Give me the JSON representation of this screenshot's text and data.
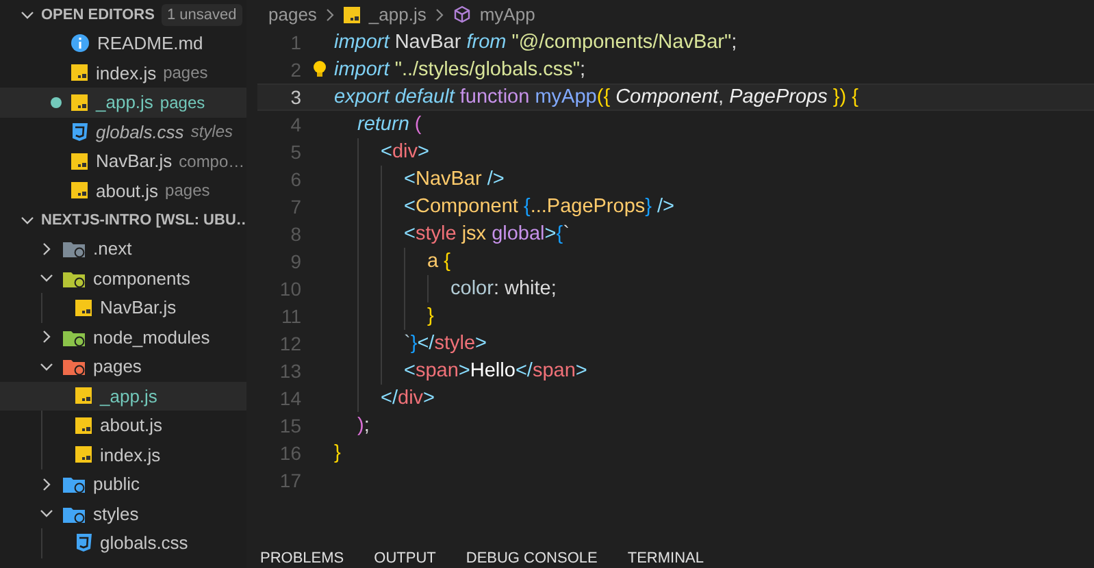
{
  "open_editors": {
    "title": "OPEN EDITORS",
    "expanded": true,
    "badge": "1 unsaved",
    "items": [
      {
        "kind": "info",
        "name": "README.md",
        "selected": false,
        "unsaved": false,
        "preview": false,
        "modified": false
      },
      {
        "kind": "js",
        "name": "index.js",
        "detail": "pages",
        "selected": false,
        "unsaved": false,
        "preview": false,
        "modified": false
      },
      {
        "kind": "js",
        "name": "_app.js",
        "detail": "pages",
        "selected": true,
        "unsaved": true,
        "preview": false,
        "modified": true
      },
      {
        "kind": "css",
        "name": "globals.css",
        "detail": "styles",
        "selected": false,
        "unsaved": false,
        "preview": true,
        "modified": false
      },
      {
        "kind": "js",
        "name": "NavBar.js",
        "detail": "compo…",
        "selected": false,
        "unsaved": false,
        "preview": false,
        "modified": false
      },
      {
        "kind": "js",
        "name": "about.js",
        "detail": "pages",
        "selected": false,
        "unsaved": false,
        "preview": false,
        "modified": false
      }
    ]
  },
  "explorer": {
    "title": "NEXTJS-INTRO [WSL: UBU…",
    "expanded": true,
    "items": [
      {
        "kind": "next",
        "name": ".next",
        "expanded": false,
        "selected": false,
        "modified": false
      },
      {
        "kind": "components",
        "name": "components",
        "expanded": true,
        "selected": false,
        "modified": false,
        "children": [
          {
            "kind": "js",
            "name": "NavBar.js",
            "selected": false,
            "modified": false
          }
        ]
      },
      {
        "kind": "node",
        "name": "node_modules",
        "expanded": false,
        "selected": false,
        "modified": false
      },
      {
        "kind": "pages",
        "name": "pages",
        "expanded": true,
        "selected": false,
        "modified": false,
        "children": [
          {
            "kind": "js",
            "name": "_app.js",
            "selected": true,
            "modified": true
          },
          {
            "kind": "js",
            "name": "about.js",
            "selected": false,
            "modified": false
          },
          {
            "kind": "js",
            "name": "index.js",
            "selected": false,
            "modified": false
          }
        ]
      },
      {
        "kind": "public",
        "name": "public",
        "expanded": false,
        "selected": false,
        "modified": false
      },
      {
        "kind": "styles",
        "name": "styles",
        "expanded": true,
        "selected": false,
        "modified": false,
        "children": [
          {
            "kind": "css",
            "name": "globals.css",
            "selected": false,
            "modified": false
          }
        ]
      }
    ]
  },
  "breadcrumbs": [
    {
      "kind": "folder",
      "label": "pages"
    },
    {
      "kind": "js",
      "label": "_app.js"
    },
    {
      "kind": "symbol",
      "label": "myApp"
    }
  ],
  "code": [
    {
      "number": "1",
      "current": false,
      "tokens": [
        {
          "kind": "kw",
          "text": "import"
        },
        {
          "kind": "plain",
          "text": " NavBar "
        },
        {
          "kind": "kw",
          "text": "from"
        },
        {
          "kind": "str",
          "text": " \"@/components/NavBar\""
        },
        {
          "kind": "plain",
          "text": ";"
        }
      ]
    },
    {
      "number": "2",
      "current": false,
      "lightbulb": true,
      "tokens": [
        {
          "kind": "kw",
          "text": "import"
        },
        {
          "kind": "str",
          "text": " \"../styles/globals.css\""
        },
        {
          "kind": "plain",
          "text": ";"
        }
      ]
    },
    {
      "number": "3",
      "current": true,
      "tokens": [
        {
          "kind": "kw",
          "text": "export default"
        },
        {
          "kind": "storage",
          "text": " function"
        },
        {
          "kind": "fn",
          "text": " myApp"
        },
        {
          "kind": "b1",
          "text": "({"
        },
        {
          "kind": "param",
          "text": " Component"
        },
        {
          "kind": "plain",
          "text": ", "
        },
        {
          "kind": "param",
          "text": "PageProps "
        },
        {
          "kind": "b1",
          "text": "}) {"
        }
      ],
      "children": [
        {
          "number": "4",
          "current": false,
          "tokens": [
            {
              "kind": "kw",
              "text": "return"
            },
            {
              "kind": "b2",
              "text": " ("
            }
          ],
          "children": [
            {
              "number": "5",
              "current": false,
              "tokens": [
                {
                  "kind": "tagp",
                  "text": "<"
                },
                {
                  "kind": "tag",
                  "text": "div"
                },
                {
                  "kind": "tagp",
                  "text": ">"
                }
              ],
              "children": [
                {
                  "number": "6",
                  "current": false,
                  "tokens": [
                    {
                      "kind": "tagp",
                      "text": "<"
                    },
                    {
                      "kind": "comp",
                      "text": "NavBar"
                    },
                    {
                      "kind": "tagp",
                      "text": " />"
                    }
                  ]
                },
                {
                  "number": "7",
                  "current": false,
                  "tokens": [
                    {
                      "kind": "tagp",
                      "text": "<"
                    },
                    {
                      "kind": "comp",
                      "text": "Component"
                    },
                    {
                      "kind": "b3",
                      "text": " {"
                    },
                    {
                      "kind": "comp",
                      "text": "...PageProps"
                    },
                    {
                      "kind": "b3",
                      "text": "}"
                    },
                    {
                      "kind": "tagp",
                      "text": " />"
                    }
                  ]
                },
                {
                  "number": "8",
                  "current": false,
                  "tokens": [
                    {
                      "kind": "tagp",
                      "text": "<"
                    },
                    {
                      "kind": "tag",
                      "text": "style"
                    },
                    {
                      "kind": "comp",
                      "text": " jsx"
                    },
                    {
                      "kind": "storage",
                      "text": " global"
                    },
                    {
                      "kind": "tagp",
                      "text": ">"
                    },
                    {
                      "kind": "b3",
                      "text": "{"
                    },
                    {
                      "kind": "plain",
                      "text": "`"
                    }
                  ],
                  "children": [
                    {
                      "number": "9",
                      "current": false,
                      "tokens": [
                        {
                          "kind": "comp",
                          "text": "a"
                        },
                        {
                          "kind": "b1",
                          "text": " {"
                        }
                      ],
                      "children": [
                        {
                          "number": "10",
                          "current": false,
                          "tokens": [
                            {
                              "kind": "prop",
                              "text": "color"
                            },
                            {
                              "kind": "plain",
                              "text": ": white;"
                            }
                          ]
                        }
                      ]
                    },
                    {
                      "number": "11",
                      "current": false,
                      "tokens": [
                        {
                          "kind": "b1",
                          "text": "}"
                        }
                      ]
                    }
                  ]
                },
                {
                  "number": "12",
                  "current": false,
                  "tokens": [
                    {
                      "kind": "prop",
                      "text": "`"
                    },
                    {
                      "kind": "b3",
                      "text": "}"
                    },
                    {
                      "kind": "tagp",
                      "text": "</"
                    },
                    {
                      "kind": "tag",
                      "text": "style"
                    },
                    {
                      "kind": "tagp",
                      "text": ">"
                    }
                  ]
                },
                {
                  "number": "13",
                  "current": false,
                  "tokens": [
                    {
                      "kind": "tagp",
                      "text": "<"
                    },
                    {
                      "kind": "tag",
                      "text": "span"
                    },
                    {
                      "kind": "tagp",
                      "text": ">"
                    },
                    {
                      "kind": "bright",
                      "text": "Hello"
                    },
                    {
                      "kind": "tagp",
                      "text": "</"
                    },
                    {
                      "kind": "tag",
                      "text": "span"
                    },
                    {
                      "kind": "tagp",
                      "text": ">"
                    }
                  ]
                }
              ]
            },
            {
              "number": "14",
              "current": false,
              "tokens": [
                {
                  "kind": "tagp",
                  "text": "</"
                },
                {
                  "kind": "tag",
                  "text": "div"
                },
                {
                  "kind": "tagp",
                  "text": ">"
                }
              ]
            }
          ]
        },
        {
          "number": "15",
          "current": false,
          "tokens": [
            {
              "kind": "b2",
              "text": ")"
            },
            {
              "kind": "plain",
              "text": ";"
            }
          ]
        }
      ]
    },
    {
      "number": "16",
      "current": false,
      "tokens": [
        {
          "kind": "b1",
          "text": "}"
        }
      ]
    },
    {
      "number": "17",
      "current": false
    }
  ],
  "panel_tabs": [
    "PROBLEMS",
    "OUTPUT",
    "DEBUG CONSOLE",
    "TERMINAL"
  ]
}
